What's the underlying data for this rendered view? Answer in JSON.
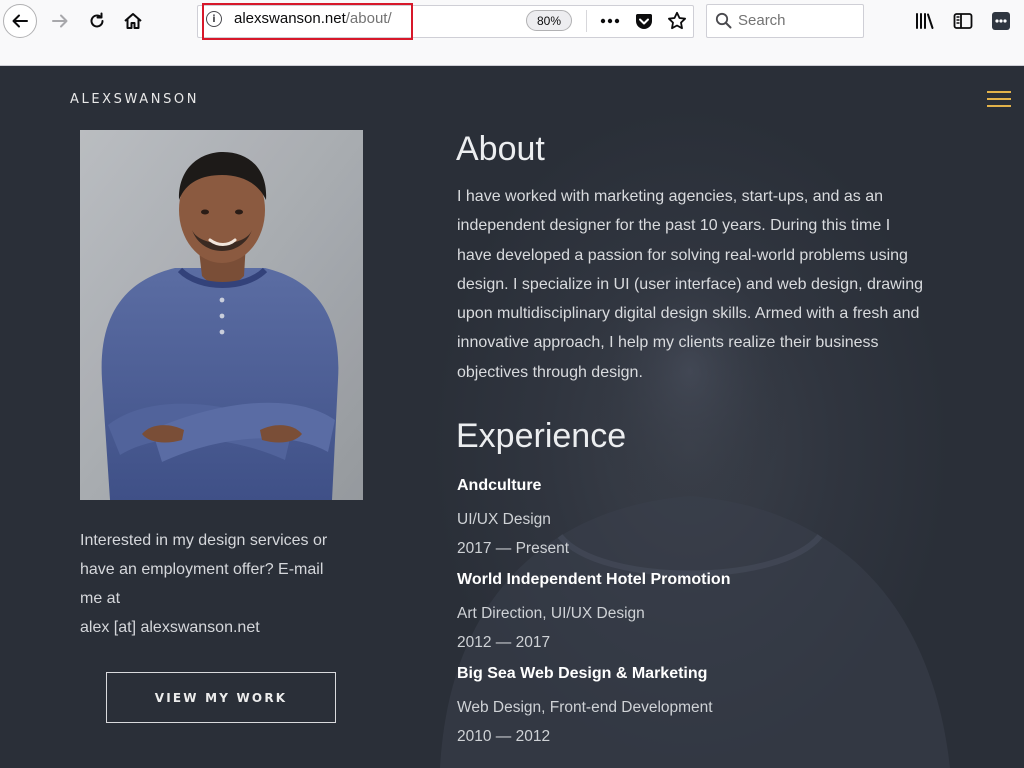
{
  "browser": {
    "url_domain": "alexswanson.net",
    "url_path": "/about/",
    "zoom": "80%",
    "search_placeholder": "Search"
  },
  "site": {
    "logo": "ALEXSWANSON",
    "accent_color": "#e2b24a"
  },
  "about": {
    "heading": "About",
    "lines": [
      "I have worked with marketing agencies, start-ups, and as an",
      "independent designer for the past 10 years. During this time I",
      "have developed a passion for solving real-world problems using",
      "design. I specialize in UI (user interface) and web design, drawing",
      "upon multidisciplinary digital design skills. Armed with a fresh and",
      "innovative approach, I help my clients realize their business",
      "objectives through design."
    ]
  },
  "contact": {
    "lines": [
      "Interested in my design services or",
      "have an employment offer? E-mail",
      "me at",
      "alex [at] alexswanson.net"
    ],
    "button_label": "VIEW MY WORK"
  },
  "experience": {
    "heading": "Experience",
    "jobs": [
      {
        "company": "Andculture",
        "role": "UI/UX Design",
        "years": "2017 — Present"
      },
      {
        "company": "World Independent Hotel Promotion",
        "role": "Art Direction, UI/UX Design",
        "years": "2012 — 2017"
      },
      {
        "company": "Big Sea Web Design & Marketing",
        "role": "Web Design, Front-end Development",
        "years": "2010 — 2012"
      }
    ]
  }
}
